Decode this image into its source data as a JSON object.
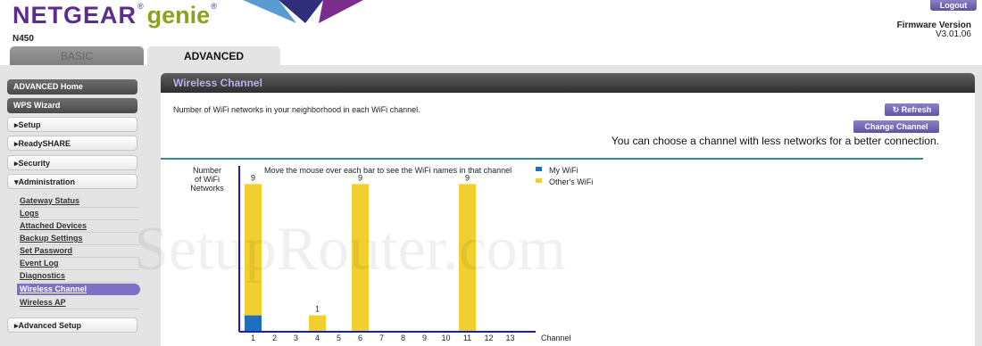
{
  "header": {
    "brand": "NETGEAR",
    "reg": "®",
    "product": "genie",
    "model": "N450",
    "logout_label": "Logout",
    "firmware_label": "Firmware Version",
    "firmware_value": "V3.01.06"
  },
  "tabs": {
    "basic": "BASIC",
    "advanced": "ADVANCED"
  },
  "sidebar": {
    "advanced_home": "ADVANCED Home",
    "wps_wizard": "WPS Wizard",
    "setup": "Setup",
    "readyshare": "ReadySHARE",
    "security": "Security",
    "administration": "Administration",
    "admin_items": [
      "Gateway Status",
      "Logs",
      "Attached Devices",
      "Backup Settings",
      "Set Password",
      "Event Log",
      "Diagnostics",
      "Wireless Channel",
      "Wireless AP"
    ],
    "advanced_setup": "Advanced Setup",
    "collapsed_arrow": "▸",
    "expanded_arrow": "▾"
  },
  "page": {
    "title": "Wireless Channel",
    "description": "Number of WiFi networks in your neighborhood in each WiFi channel.",
    "refresh_label": "Refresh",
    "refresh_icon": "↻",
    "change_channel_label": "Change Channel",
    "hint": "You can choose a channel with less networks for a better connection."
  },
  "watermark": "SetupRouter.com",
  "colors": {
    "accent": "#6a5fb0",
    "my_wifi": "#1f6fbf",
    "others_wifi": "#f0cf2e",
    "axis": "#1b1bcc"
  },
  "chart_data": {
    "type": "bar",
    "ylabel": "Number\nof WiFi\nNetworks",
    "xlabel": "Channel",
    "annotation": "Move the mouse over each bar to see the WiFi names in that channel",
    "categories": [
      "1",
      "2",
      "3",
      "4",
      "5",
      "6",
      "7",
      "8",
      "9",
      "10",
      "11",
      "12",
      "13"
    ],
    "series": [
      {
        "name": "My WiFi",
        "values": [
          1,
          0,
          0,
          0,
          0,
          0,
          0,
          0,
          0,
          0,
          0,
          0,
          0
        ]
      },
      {
        "name": "Other's WiFi",
        "values": [
          8,
          0,
          0,
          1,
          0,
          9,
          0,
          0,
          0,
          0,
          9,
          0,
          0
        ]
      }
    ],
    "totals": [
      9,
      0,
      0,
      1,
      0,
      9,
      0,
      0,
      0,
      0,
      9,
      0,
      0
    ],
    "stacked": true,
    "ylim": [
      0,
      10
    ]
  }
}
